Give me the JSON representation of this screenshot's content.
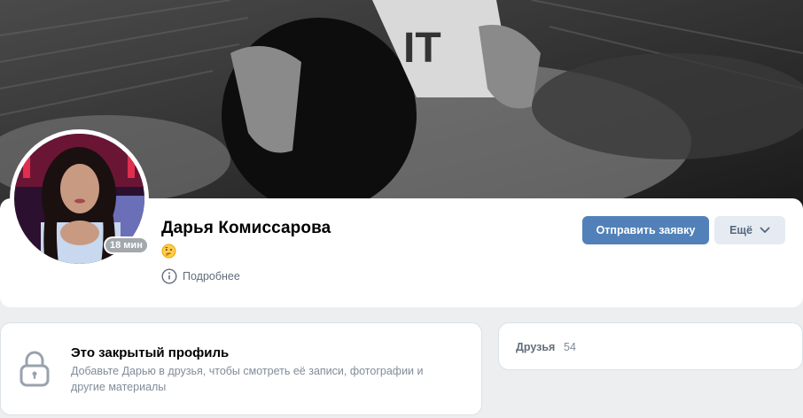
{
  "profile": {
    "name": "Дарья Комиссарова",
    "status_emoji": "🤔",
    "online_badge": "18 мин",
    "details_label": "Подробнее"
  },
  "actions": {
    "primary_label": "Отправить заявку",
    "more_label": "Ещё"
  },
  "closed_profile": {
    "title": "Это закрытый профиль",
    "description": "Добавьте Дарью в друзья, чтобы смотреть её записи, фотографии и другие материалы"
  },
  "friends": {
    "label": "Друзья",
    "count": "54"
  },
  "icons": {
    "details": "info-icon",
    "more": "chevron-down-icon",
    "closed": "lock-icon"
  },
  "colors": {
    "accent": "#5181b8",
    "secondary_button": "#e5ebf1",
    "page_background": "#edeef0"
  }
}
